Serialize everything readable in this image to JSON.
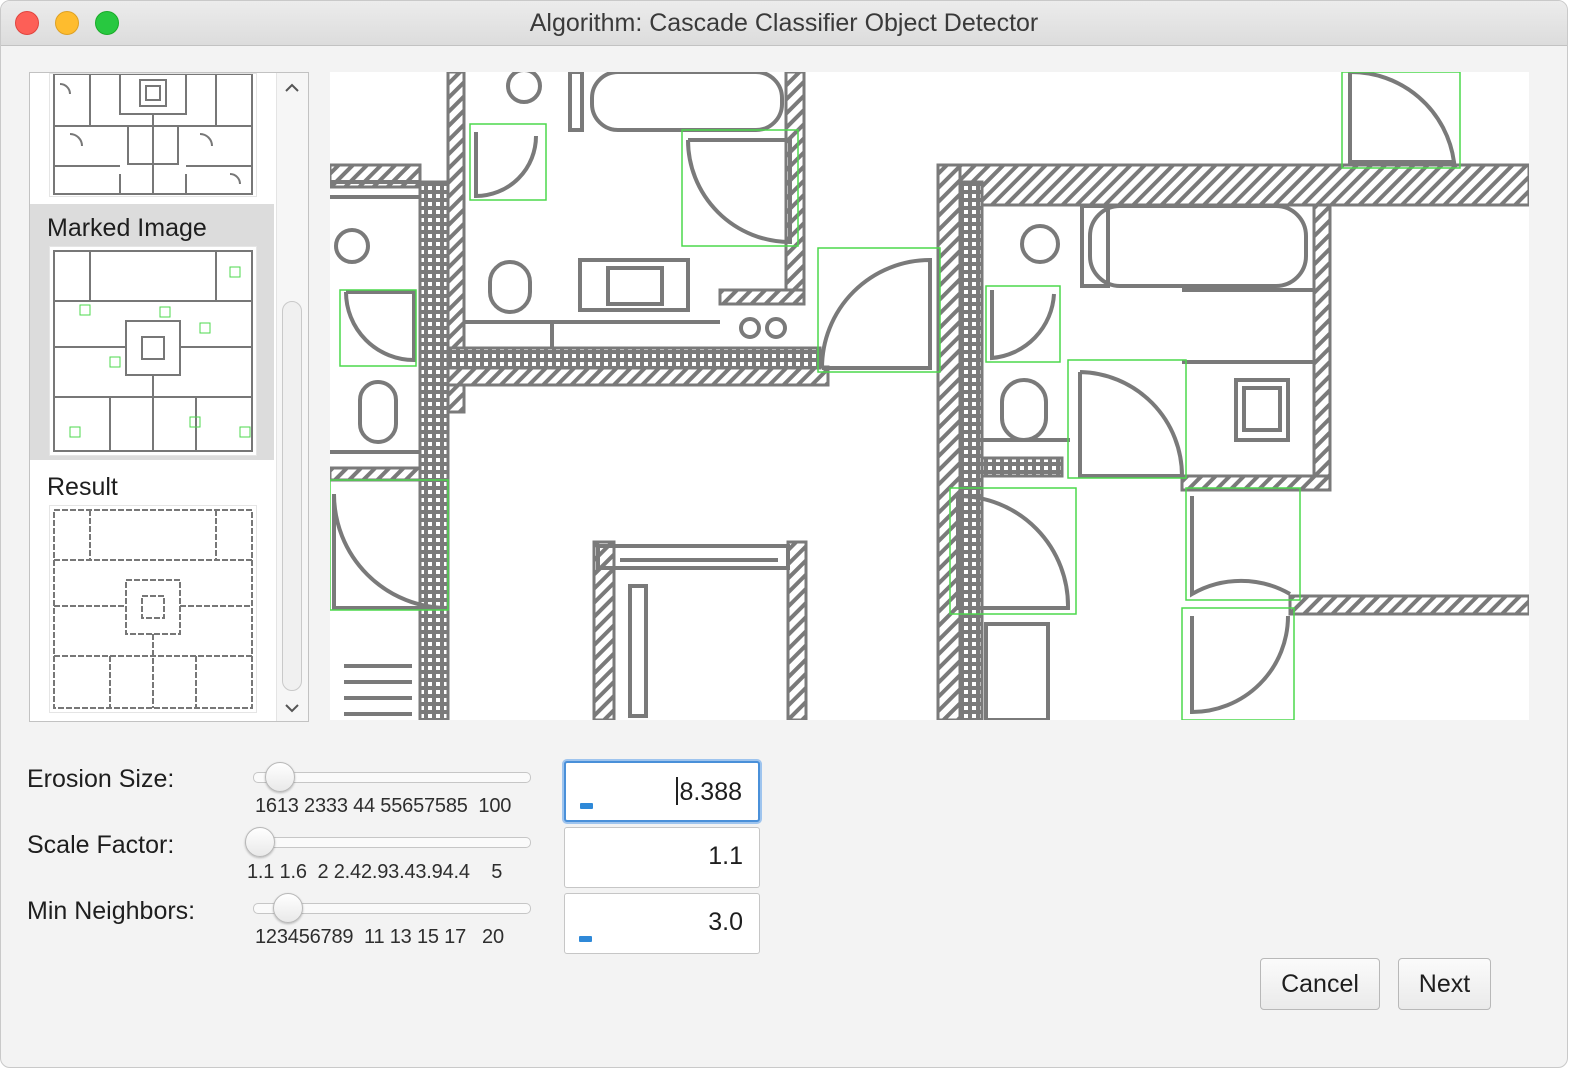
{
  "window": {
    "title": "Algorithm: Cascade Classifier Object Detector"
  },
  "steps": [
    {
      "label": ""
    },
    {
      "label": "Marked Image"
    },
    {
      "label": "Result"
    }
  ],
  "controls": [
    {
      "label": "Erosion Size:",
      "value": "8.388",
      "ticks": "1613 2333 44 55657585  100",
      "slider_fraction": 0.07
    },
    {
      "label": "Scale Factor:",
      "value": "1.1",
      "ticks": "1.1 1.6  2 2.42.93.43.94.4    5",
      "slider_fraction": 0.0
    },
    {
      "label": "Min Neighbors:",
      "value": "3.0",
      "ticks": "123456789  11 13 15 17   20",
      "slider_fraction": 0.11
    }
  ],
  "buttons": {
    "cancel": "Cancel",
    "next": "Next"
  },
  "colors": {
    "accent": "#4a90d9",
    "detection_box": "#4cd84c",
    "plan_line": "#808080"
  }
}
